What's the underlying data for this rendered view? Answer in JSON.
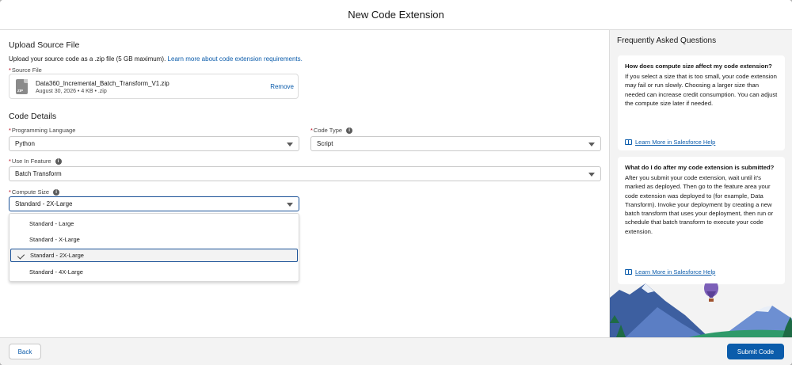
{
  "modal": {
    "title": "New Code Extension"
  },
  "upload": {
    "heading": "Upload Source File",
    "description": "Upload your source code as a .zip file (5 GB maximum).",
    "link": "Learn more about code extension requirements.",
    "source_label": "Source File",
    "file": {
      "icon": "zip-file-icon",
      "icon_text": "ZIP",
      "name": "Data360_Incremental_Batch_Transform_V1.zip",
      "meta": "August 30, 2026 • 4 KB • .zip",
      "remove_label": "Remove"
    }
  },
  "code_details": {
    "heading": "Code Details",
    "programming_language": {
      "label": "Programming Language",
      "value": "Python"
    },
    "code_type": {
      "label": "Code Type",
      "value": "Script"
    },
    "use_in_feature": {
      "label": "Use In Feature",
      "value": "Batch Transform"
    },
    "compute_size": {
      "label": "Compute Size",
      "value": "Standard - 2X-Large",
      "options": [
        "Standard - Large",
        "Standard - X-Large",
        "Standard - 2X-Large",
        "Standard - 4X-Large"
      ],
      "selected_index": 2
    }
  },
  "faq": {
    "title": "Frequently Asked Questions",
    "items": [
      {
        "question": "How does compute size affect my code extension?",
        "answer": "If you select a size that is too small, your code extension may fail or run slowly. Choosing a larger size than needed can increase credit consumption. You can adjust the compute size later if needed.",
        "link": "Learn More in Salesforce Help"
      },
      {
        "question": "What do I do after my code extension is submitted?",
        "answer": "After you submit your code extension, wait until it's marked as deployed. Then go to the feature area your code extension was deployed to (for example, Data Transform). Invoke your deployment by creating a new batch transform that uses your deployment, then run or schedule that batch transform to execute your code extension.",
        "link": "Learn More in Salesforce Help"
      }
    ]
  },
  "footer": {
    "back_label": "Back",
    "submit_label": "Submit Code"
  },
  "colors": {
    "brand": "#0b5cab",
    "required": "#ba0517",
    "focus": "#1b5297",
    "panel": "#f3f3f3"
  }
}
